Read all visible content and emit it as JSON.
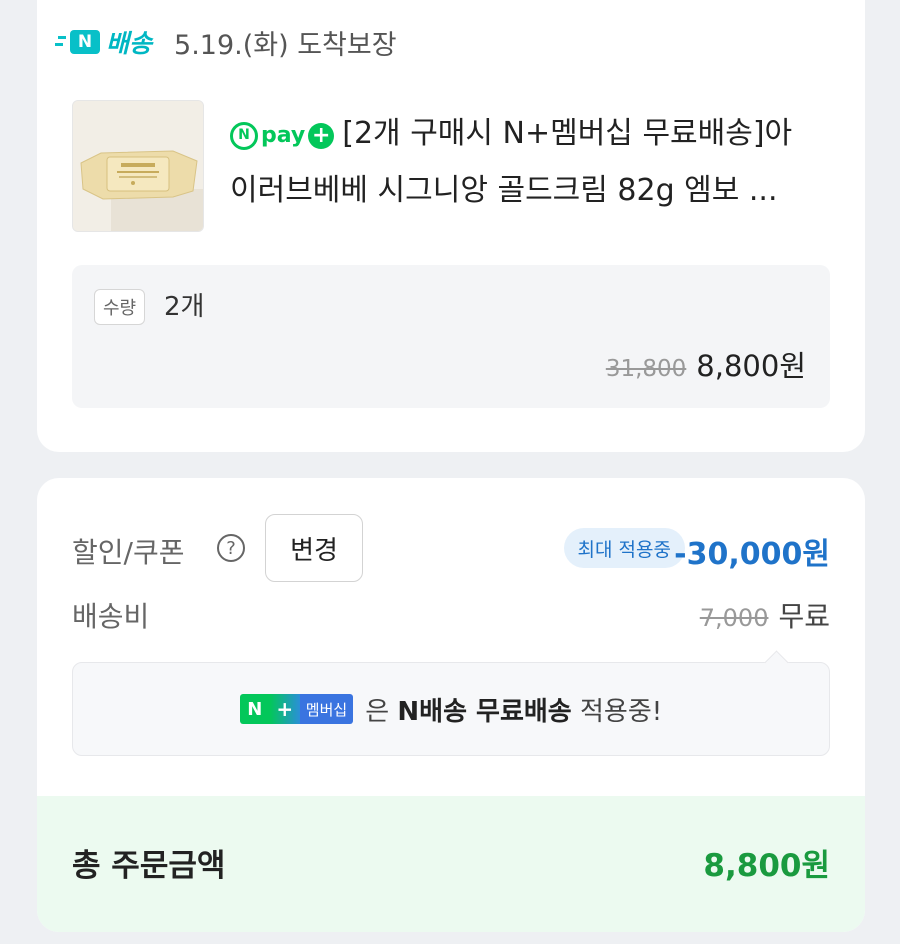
{
  "delivery": {
    "badge_label": "배송",
    "badge_letter": "N",
    "date_text": "5.19.(화) 도착보장"
  },
  "product": {
    "npay_letter": "N",
    "npay_text": "pay",
    "npay_plus": "+",
    "title_line1": "[2개 구매시 N+멤버십 무료배송]아",
    "title_line2": "이러브베베 시그니앙 골드크림 82g 엠보 ...",
    "quantity_label": "수량",
    "quantity_value": "2개",
    "original_price": "31,800",
    "final_price": "8,800원"
  },
  "discount": {
    "label": "할인/쿠폰",
    "help_icon": "?",
    "change_button": "변경",
    "badge": "최대 적용중",
    "amount": "-30,000원"
  },
  "shipping": {
    "label": "배송비",
    "original": "7,000",
    "value": "무료"
  },
  "promo": {
    "badge_n": "N",
    "badge_plus": "+",
    "badge_text": "멤버십",
    "text_pre": "은 ",
    "text_bold": "N배송 무료배송",
    "text_post": " 적용중!"
  },
  "total": {
    "label": "총 주문금액",
    "amount": "8,800원"
  },
  "colors": {
    "accent_blue": "#1f73c9",
    "accent_green": "#1a9a3f",
    "npay_green": "#03c75a",
    "delivery_teal": "#08c0c8"
  }
}
